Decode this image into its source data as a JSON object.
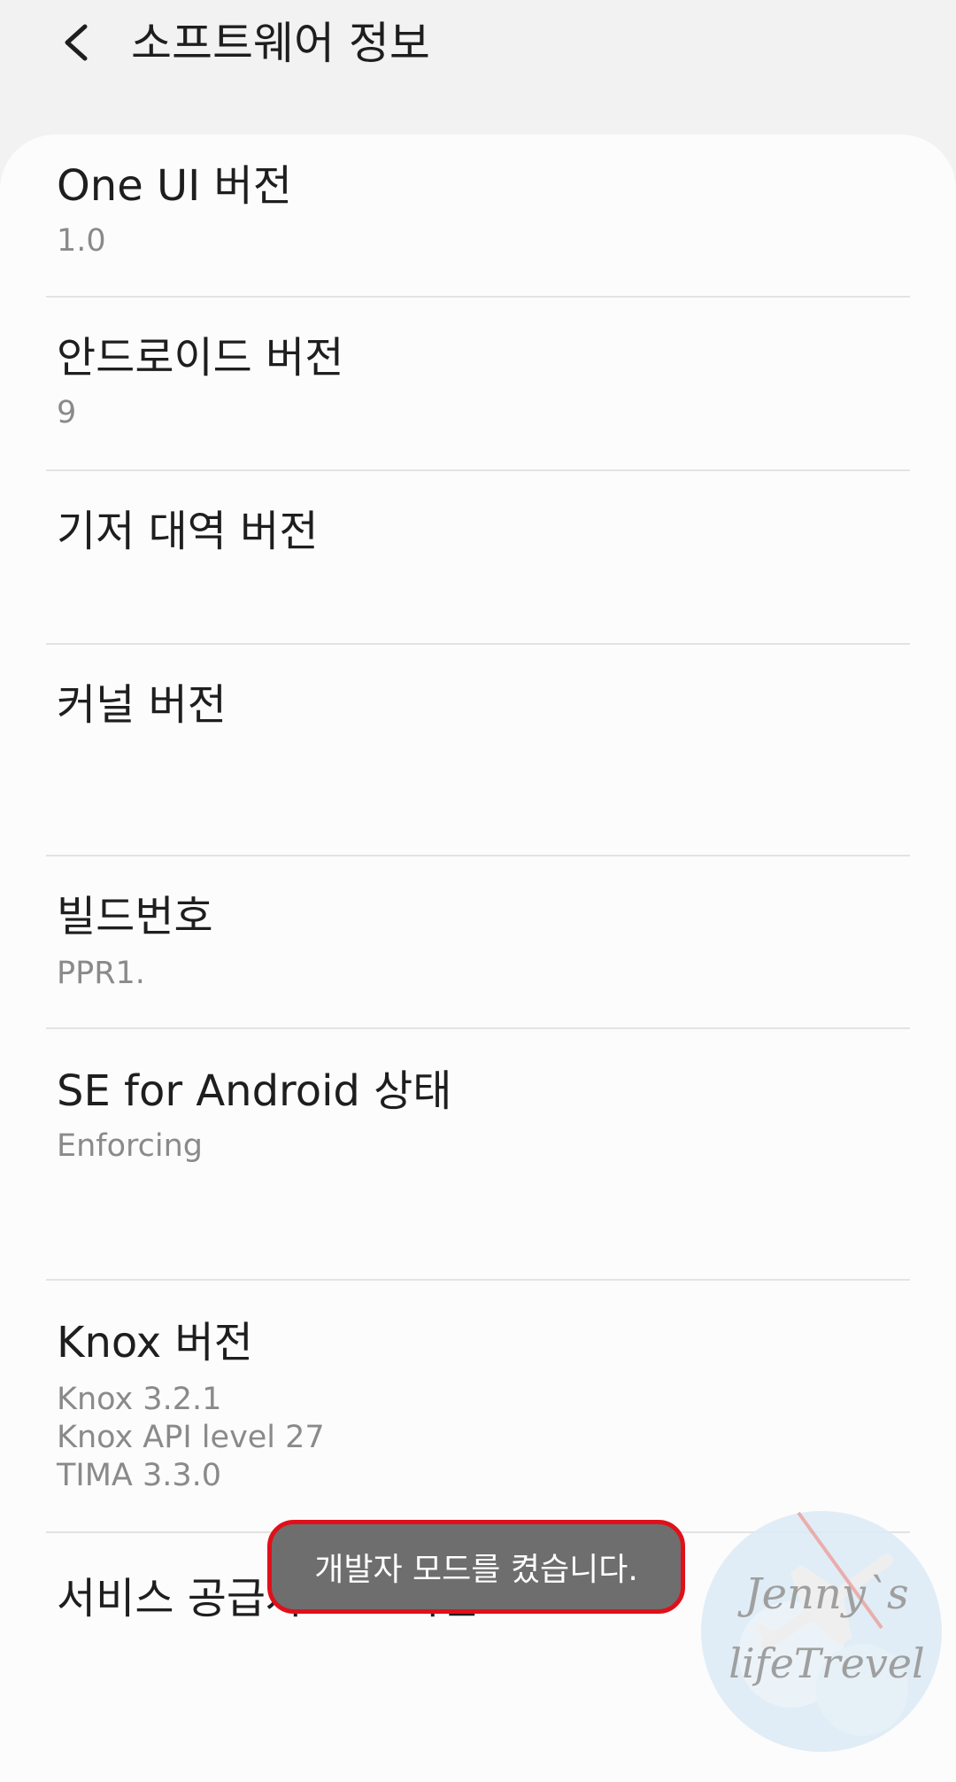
{
  "header": {
    "back_icon": "chevron-left-icon",
    "title": "소프트웨어 정보"
  },
  "items": [
    {
      "title": "One UI 버전",
      "subtitle": "1.0"
    },
    {
      "title": "안드로이드 버전",
      "subtitle": "9"
    },
    {
      "title": "기저 대역 버전",
      "subtitle": ""
    },
    {
      "title": "커널 버전",
      "subtitle": ""
    },
    {
      "title": "빌드번호",
      "subtitle": "PPR1."
    },
    {
      "title": "SE for Android 상태",
      "subtitle": "Enforcing"
    },
    {
      "title": "Knox 버전",
      "lines": [
        "Knox 3.2.1",
        "Knox API level 27",
        "TIMA 3.3.0"
      ]
    },
    {
      "title": "서비스 공급자 SW 버전",
      "subtitle": ""
    }
  ],
  "toast": {
    "message": "개발자 모드를 켰습니다."
  },
  "watermark": {
    "line1": "Jenny`s",
    "line2": "lifeTrevel",
    "icon": "airplane-icon"
  },
  "colors": {
    "toast_bg": "#6e6e6e",
    "toast_border": "#e0101a",
    "subtitle": "#8a8a8a"
  }
}
